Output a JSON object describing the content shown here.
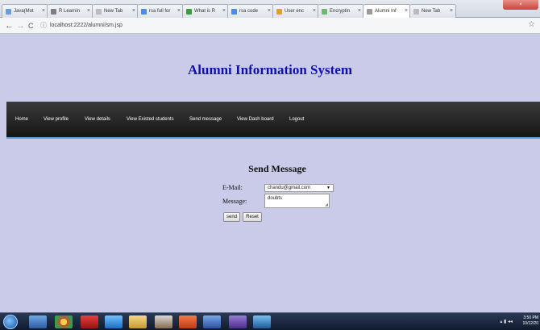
{
  "browser": {
    "tabs": [
      {
        "label": "Java(Mot",
        "color": "#6a9de0",
        "active": false
      },
      {
        "label": "R Learnin",
        "color": "#7f7f7f",
        "active": false
      },
      {
        "label": "New Tab",
        "color": "#bbbbbb",
        "active": false
      },
      {
        "label": "rsa full for",
        "color": "#4a8af4",
        "active": false
      },
      {
        "label": "What is R",
        "color": "#3c9b3c",
        "active": false
      },
      {
        "label": "rsa code",
        "color": "#4a8af4",
        "active": false
      },
      {
        "label": "User enc",
        "color": "#e5a11b",
        "active": false
      },
      {
        "label": "Encryptin",
        "color": "#6cb86c",
        "active": false
      },
      {
        "label": "Alumni Inf",
        "color": "#999999",
        "active": true
      },
      {
        "label": "New Tab",
        "color": "#bbbbbb",
        "active": false
      }
    ],
    "url": "localhost:2222/alumni/sm.jsp"
  },
  "page": {
    "title": "Alumni Information System",
    "nav": [
      "Home",
      "View profile",
      "View details",
      "View Existed students",
      "Send message",
      "View Dash board",
      "Logout"
    ],
    "form": {
      "heading": "Send Message",
      "email_label": "E-Mail:",
      "email_value": "chandu@gmail.com",
      "message_label": "Message:",
      "message_value": "doubts",
      "send_label": "send",
      "reset_label": "Reset"
    }
  },
  "taskbar": {
    "time": "3:50 PM",
    "date": "10/12/20"
  }
}
